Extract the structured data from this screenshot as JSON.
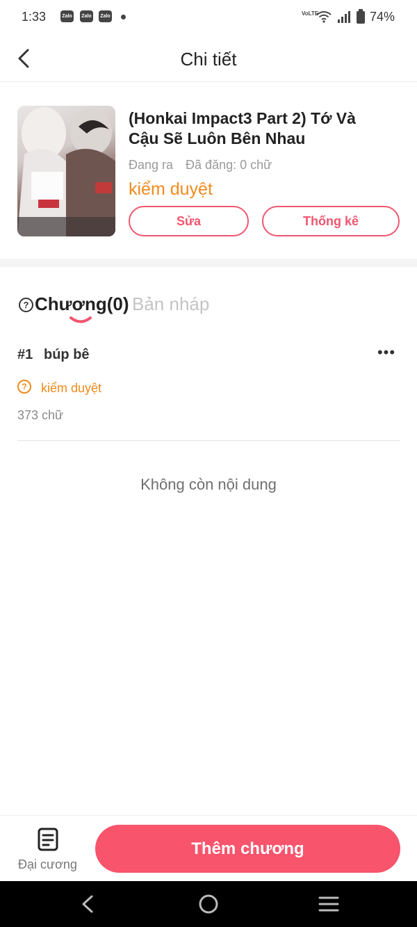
{
  "status_bar": {
    "time": "1:33",
    "notification_icons": [
      "Zalo",
      "Zalo",
      "Zalo"
    ],
    "network_label": "VoLTE",
    "battery": "74%"
  },
  "header": {
    "title": "Chi tiết",
    "back_icon": "chevron-left-icon"
  },
  "book": {
    "title": "(Honkai Impact3 Part 2) Tớ Và Cậu Sẽ Luôn Bên Nhau",
    "status": "Đang ra",
    "posted": "Đã đăng: 0 chữ",
    "review_status": "kiểm duyệt",
    "edit_label": "Sửa",
    "stats_label": "Thống kê"
  },
  "tabs": {
    "help_icon": "question-circle-icon",
    "chapters": "Chương(0)",
    "drafts": "Bản nháp"
  },
  "chapters": [
    {
      "number": "#1",
      "title": "búp bê",
      "status": "kiểm duyệt",
      "words": "373 chữ"
    }
  ],
  "empty_message": "Không còn nội dung",
  "bottom_bar": {
    "outline_label": "Đại cương",
    "add_chapter_label": "Thêm chương"
  },
  "colors": {
    "accent": "#f8546c",
    "review": "#f08a1c"
  }
}
